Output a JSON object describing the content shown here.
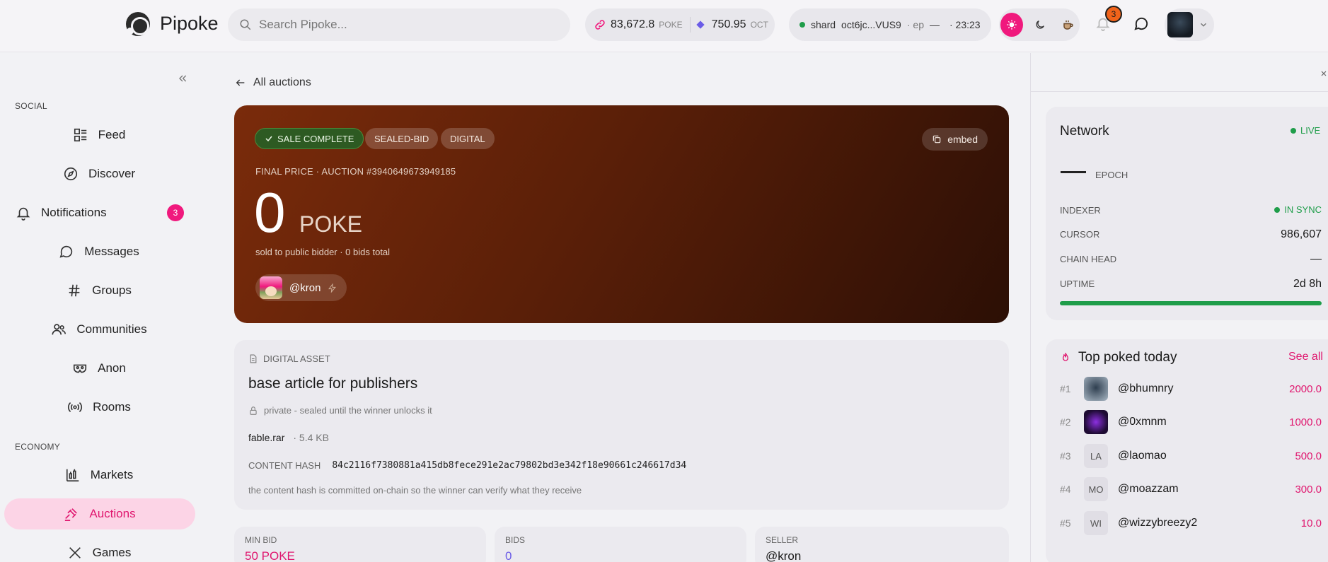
{
  "header": {
    "brand": "Pipoke",
    "search_placeholder": "Search Pipoke...",
    "poke_balance": "83,672.8",
    "poke_unit": "POKE",
    "oct_balance": "750.95",
    "oct_unit": "OCT",
    "shard_label": "shard",
    "shard_id": "oct6jc...VUS9",
    "ep_label": "· ep",
    "ep_value": "—",
    "time": "· 23:23",
    "notif_count": "3"
  },
  "sidebar": {
    "section_social": "SOCIAL",
    "section_economy": "ECONOMY",
    "items": [
      {
        "label": "Feed"
      },
      {
        "label": "Discover"
      },
      {
        "label": "Notifications",
        "badge": "3"
      },
      {
        "label": "Messages"
      },
      {
        "label": "Groups"
      },
      {
        "label": "Communities"
      },
      {
        "label": "Anon"
      },
      {
        "label": "Rooms"
      },
      {
        "label": "Markets"
      },
      {
        "label": "Auctions"
      },
      {
        "label": "Games"
      }
    ]
  },
  "main": {
    "back_label": "All auctions",
    "chips": {
      "sale": "SALE COMPLETE",
      "sealed": "SEALED-BID",
      "digital": "DIGITAL"
    },
    "embed_label": "embed",
    "final_label": "FINAL PRICE · AUCTION #3940649673949185",
    "price": "0",
    "price_unit": "POKE",
    "sold_text": "sold to public bidder · 0 bids total",
    "seller_handle": "@kron",
    "asset_label": "DIGITAL ASSET",
    "asset_title": "base article for publishers",
    "private_text": "private - sealed until the winner unlocks it",
    "file_name": "fable.rar",
    "file_size": "· 5.4 KB",
    "hash_label": "CONTENT HASH",
    "hash_value": "84c2116f7380881a415db8fece291e2ac79802bd3e342f18e90661c246617d34",
    "hash_note": "the content hash is committed on-chain so the winner can verify what they receive",
    "stats": [
      {
        "label": "MIN BID",
        "value": "50 POKE",
        "color": "#e0176f"
      },
      {
        "label": "BIDS",
        "value": "0",
        "color": "#6b5ce7"
      },
      {
        "label": "SELLER",
        "value": "@kron",
        "color": "#1a1a1a"
      }
    ]
  },
  "network": {
    "title": "Network",
    "live": "LIVE",
    "epoch_label": "EPOCH",
    "rows": [
      {
        "key": "INDEXER",
        "value": "IN SYNC"
      },
      {
        "key": "CURSOR",
        "value": "986,607"
      },
      {
        "key": "CHAIN HEAD",
        "value": "—"
      },
      {
        "key": "UPTIME",
        "value": "2d 8h"
      }
    ]
  },
  "top_poked": {
    "title": "Top poked today",
    "see_all": "See all",
    "rows": [
      {
        "rank": "#1",
        "initials": "",
        "handle": "@bhumnry",
        "score": "2000.0"
      },
      {
        "rank": "#2",
        "initials": "",
        "handle": "@0xmnm",
        "score": "1000.0"
      },
      {
        "rank": "#3",
        "initials": "LA",
        "handle": "@laomao",
        "score": "500.0"
      },
      {
        "rank": "#4",
        "initials": "MO",
        "handle": "@moazzam",
        "score": "300.0"
      },
      {
        "rank": "#5",
        "initials": "WI",
        "handle": "@wizzybreezy2",
        "score": "10.0"
      }
    ]
  }
}
